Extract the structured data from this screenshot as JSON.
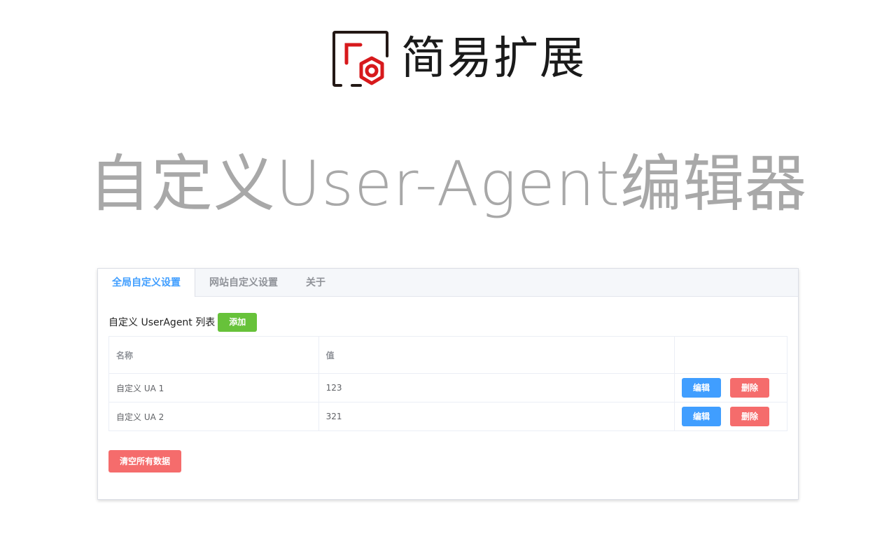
{
  "brand": {
    "name": "简易扩展",
    "logo_colors": {
      "frame": "#231815",
      "accent": "#d7191c"
    }
  },
  "hero": {
    "title": "自定义User-Agent编辑器"
  },
  "tabs": [
    {
      "label": "全局自定义设置",
      "active": true
    },
    {
      "label": "网站自定义设置",
      "active": false
    },
    {
      "label": "关于",
      "active": false
    }
  ],
  "list": {
    "heading": "自定义 UserAgent 列表",
    "add_label": "添加",
    "columns": [
      "名称",
      "值",
      ""
    ],
    "rows": [
      {
        "name": "自定义 UA 1",
        "value": "123"
      },
      {
        "name": "自定义 UA 2",
        "value": "321"
      }
    ],
    "edit_label": "编辑",
    "delete_label": "删除"
  },
  "clear_label": "清空所有数据",
  "colors": {
    "primary": "#409eff",
    "success": "#67c23a",
    "danger": "#f56c6c"
  }
}
